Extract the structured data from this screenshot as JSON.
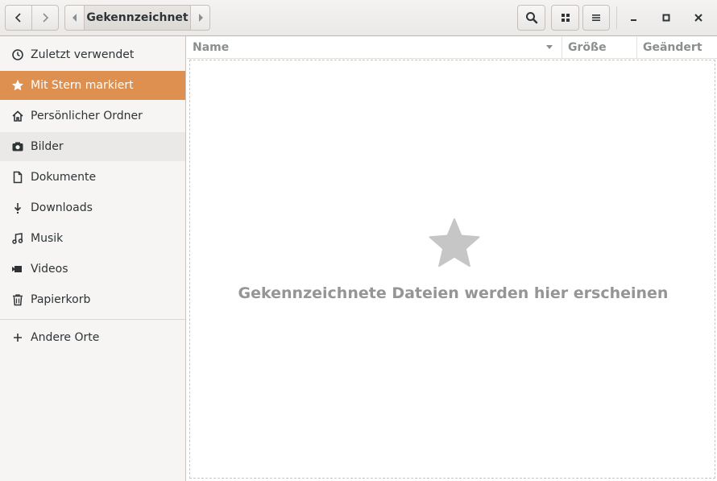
{
  "header": {
    "breadcrumb": "Gekennzeichnet"
  },
  "sidebar": {
    "items": [
      {
        "label": "Zuletzt verwendet",
        "icon": "clock-icon"
      },
      {
        "label": "Mit Stern markiert",
        "icon": "star-icon"
      },
      {
        "label": "Persönlicher Ordner",
        "icon": "home-icon"
      },
      {
        "label": "Bilder",
        "icon": "camera-icon"
      },
      {
        "label": "Dokumente",
        "icon": "document-icon"
      },
      {
        "label": "Downloads",
        "icon": "download-icon"
      },
      {
        "label": "Musik",
        "icon": "music-icon"
      },
      {
        "label": "Videos",
        "icon": "video-icon"
      },
      {
        "label": "Papierkorb",
        "icon": "trash-icon"
      }
    ],
    "other": {
      "label": "Andere Orte",
      "icon": "plus-icon"
    }
  },
  "columns": {
    "name": "Name",
    "size": "Größe",
    "modified": "Geändert"
  },
  "empty_state": {
    "message": "Gekennzeichnete Dateien werden hier erscheinen"
  },
  "colors": {
    "accent": "#dd9050",
    "empty_text": "#939596"
  }
}
